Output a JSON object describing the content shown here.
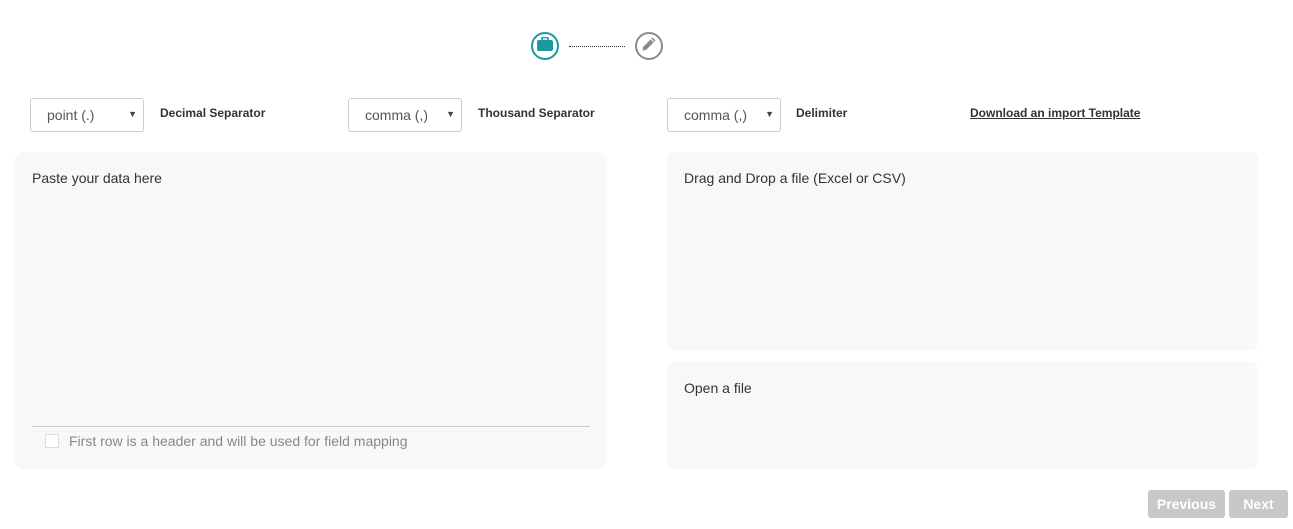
{
  "stepper": {
    "steps": [
      {
        "icon": "briefcase-icon",
        "state": "active",
        "color": "#1a9aa0"
      },
      {
        "icon": "pencil-icon",
        "state": "inactive",
        "color": "#8a8a8a"
      }
    ]
  },
  "settings": {
    "decimal_separator": {
      "value": "point (.)",
      "label": "Decimal Separator"
    },
    "thousand_separator": {
      "value": "comma (,)",
      "label": "Thousand Separator"
    },
    "delimiter": {
      "value": "comma (,)",
      "label": "Delimiter"
    },
    "template_link": "Download an import Template"
  },
  "paste_panel": {
    "placeholder": "Paste your data here",
    "header_checkbox_label": "First row is a header and will be used for field mapping"
  },
  "drop_panel": {
    "text": "Drag and Drop a file (Excel or CSV)"
  },
  "open_panel": {
    "text": "Open a file"
  },
  "footer": {
    "previous_label": "Previous",
    "next_label": "Next"
  }
}
